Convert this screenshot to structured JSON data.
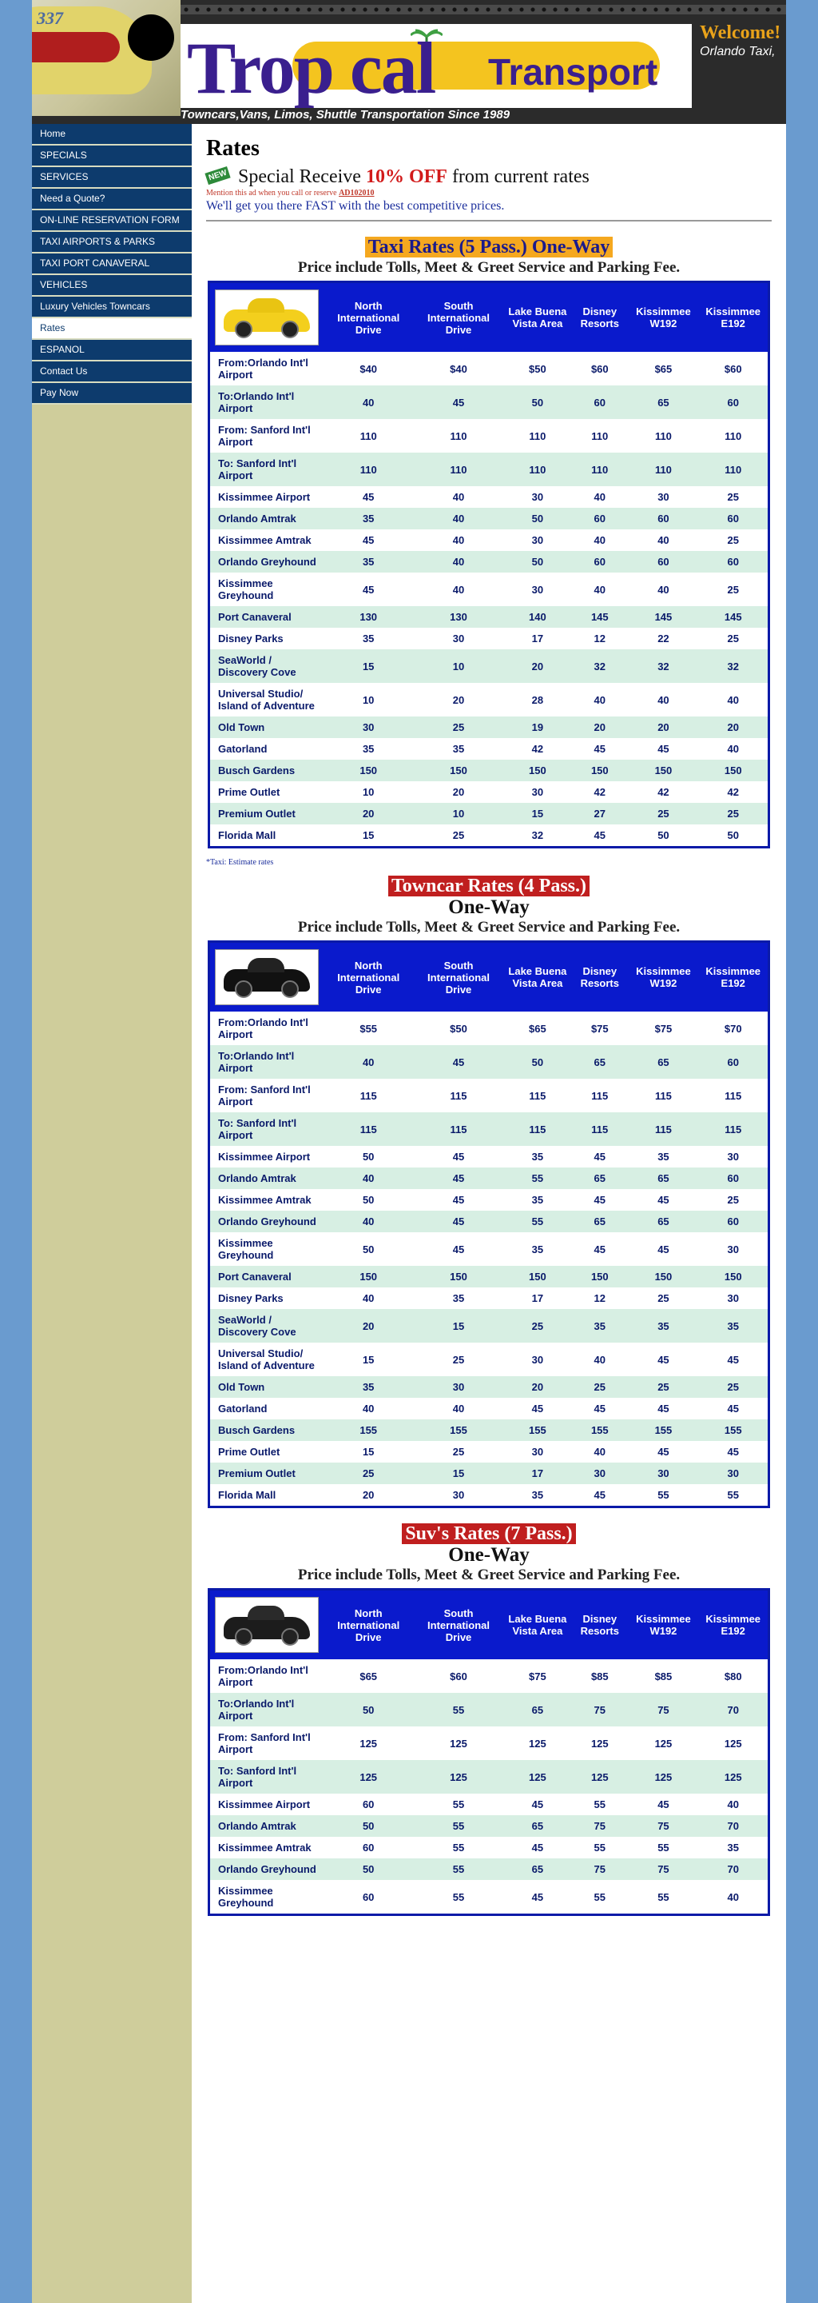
{
  "header": {
    "logo_main": "Trop  cal",
    "logo_sub": "Transport",
    "welcome": "Welcome!",
    "welcome_sub": "Orlando Taxi,",
    "tagline": "Towncars,Vans, Limos, Shuttle Transportation Since 1989",
    "plate": "337"
  },
  "nav": [
    "Home",
    "SPECIALS",
    "SERVICES",
    "Need a Quote?",
    "ON-LINE RESERVATION FORM",
    "TAXI AIRPORTS & PARKS",
    "TAXI PORT CANAVERAL",
    "VEHICLES",
    "Luxury Vehicles Towncars",
    "Rates",
    "ESPANOL",
    "Contact Us",
    "Pay Now"
  ],
  "nav_active": "Rates",
  "page": {
    "title": "Rates",
    "new_badge": "NEW",
    "special_pre": "Special  Receive ",
    "special_off": "10% OFF",
    "special_post": " from current rates",
    "mention_pre": "Mention this ad when you call or reserve ",
    "mention_code": "AD102010",
    "promise": "We'll get you there FAST with the best competitive prices."
  },
  "columns": [
    "North International Drive",
    "South International Drive",
    "Lake Buena Vista Area",
    "Disney Resorts",
    "Kissimmee W192",
    "Kissimmee E192"
  ],
  "sections": {
    "taxi": {
      "title": "Taxi Rates (5 Pass.) One-Way",
      "fee": "Price include Tolls, Meet & Greet Service and Parking Fee.",
      "note": "*Taxi: Estimate rates",
      "rows": [
        [
          "From:Orlando Int'l Airport",
          "$40",
          "$40",
          "$50",
          "$60",
          "$65",
          "$60"
        ],
        [
          "To:Orlando Int'l Airport",
          "40",
          "45",
          "50",
          "60",
          "65",
          "60"
        ],
        [
          "From: Sanford Int'l Airport",
          "110",
          "110",
          "110",
          "110",
          "110",
          "110"
        ],
        [
          "To: Sanford Int'l Airport",
          "110",
          "110",
          "110",
          "110",
          "110",
          "110"
        ],
        [
          "Kissimmee Airport",
          "45",
          "40",
          "30",
          "40",
          "30",
          "25"
        ],
        [
          "Orlando Amtrak",
          "35",
          "40",
          "50",
          "60",
          "60",
          "60"
        ],
        [
          "Kissimmee Amtrak",
          "45",
          "40",
          "30",
          "40",
          "40",
          "25"
        ],
        [
          "Orlando Greyhound",
          "35",
          "40",
          "50",
          "60",
          "60",
          "60"
        ],
        [
          "Kissimmee Greyhound",
          "45",
          "40",
          "30",
          "40",
          "40",
          "25"
        ],
        [
          "Port Canaveral",
          "130",
          "130",
          "140",
          "145",
          "145",
          "145"
        ],
        [
          "Disney Parks",
          "35",
          "30",
          "17",
          "12",
          "22",
          "25"
        ],
        [
          "SeaWorld / Discovery Cove",
          "15",
          "10",
          "20",
          "32",
          "32",
          "32"
        ],
        [
          "Universal Studio/ Island of Adventure",
          "10",
          "20",
          "28",
          "40",
          "40",
          "40"
        ],
        [
          "Old Town",
          "30",
          "25",
          "19",
          "20",
          "20",
          "20"
        ],
        [
          "Gatorland",
          "35",
          "35",
          "42",
          "45",
          "45",
          "40"
        ],
        [
          "Busch Gardens",
          "150",
          "150",
          "150",
          "150",
          "150",
          "150"
        ],
        [
          "Prime Outlet",
          "10",
          "20",
          "30",
          "42",
          "42",
          "42"
        ],
        [
          "Premium Outlet",
          "20",
          "10",
          "15",
          "27",
          "25",
          "25"
        ],
        [
          "Florida Mall",
          "15",
          "25",
          "32",
          "45",
          "50",
          "50"
        ]
      ]
    },
    "towncar": {
      "title": "Towncar Rates (4 Pass.)",
      "sub": "One-Way",
      "fee": "Price include Tolls, Meet & Greet Service and Parking Fee.",
      "rows": [
        [
          "From:Orlando Int'l Airport",
          "$55",
          "$50",
          "$65",
          "$75",
          "$75",
          "$70"
        ],
        [
          "To:Orlando Int'l Airport",
          "40",
          "45",
          "50",
          "65",
          "65",
          "60"
        ],
        [
          "From: Sanford Int'l Airport",
          "115",
          "115",
          "115",
          "115",
          "115",
          "115"
        ],
        [
          "To: Sanford Int'l Airport",
          "115",
          "115",
          "115",
          "115",
          "115",
          "115"
        ],
        [
          "Kissimmee Airport",
          "50",
          "45",
          "35",
          "45",
          "35",
          "30"
        ],
        [
          "Orlando Amtrak",
          "40",
          "45",
          "55",
          "65",
          "65",
          "60"
        ],
        [
          "Kissimmee Amtrak",
          "50",
          "45",
          "35",
          "45",
          "45",
          "25"
        ],
        [
          "Orlando Greyhound",
          "40",
          "45",
          "55",
          "65",
          "65",
          "60"
        ],
        [
          "Kissimmee Greyhound",
          "50",
          "45",
          "35",
          "45",
          "45",
          "30"
        ],
        [
          "Port Canaveral",
          "150",
          "150",
          "150",
          "150",
          "150",
          "150"
        ],
        [
          "Disney Parks",
          "40",
          "35",
          "17",
          "12",
          "25",
          "30"
        ],
        [
          "SeaWorld / Discovery Cove",
          "20",
          "15",
          "25",
          "35",
          "35",
          "35"
        ],
        [
          "Universal Studio/ Island of Adventure",
          "15",
          "25",
          "30",
          "40",
          "45",
          "45"
        ],
        [
          "Old Town",
          "35",
          "30",
          "20",
          "25",
          "25",
          "25"
        ],
        [
          "Gatorland",
          "40",
          "40",
          "45",
          "45",
          "45",
          "45"
        ],
        [
          "Busch Gardens",
          "155",
          "155",
          "155",
          "155",
          "155",
          "155"
        ],
        [
          "Prime Outlet",
          "15",
          "25",
          "30",
          "40",
          "45",
          "45"
        ],
        [
          "Premium Outlet",
          "25",
          "15",
          "17",
          "30",
          "30",
          "30"
        ],
        [
          "Florida Mall",
          "20",
          "30",
          "35",
          "45",
          "55",
          "55"
        ]
      ]
    },
    "suv": {
      "title": "Suv's Rates (7 Pass.)",
      "sub": "One-Way",
      "fee": "Price include Tolls, Meet & Greet Service and Parking Fee.",
      "rows": [
        [
          "From:Orlando Int'l Airport",
          "$65",
          "$60",
          "$75",
          "$85",
          "$85",
          "$80"
        ],
        [
          "To:Orlando Int'l Airport",
          "50",
          "55",
          "65",
          "75",
          "75",
          "70"
        ],
        [
          "From: Sanford Int'l Airport",
          "125",
          "125",
          "125",
          "125",
          "125",
          "125"
        ],
        [
          "To: Sanford Int'l Airport",
          "125",
          "125",
          "125",
          "125",
          "125",
          "125"
        ],
        [
          "Kissimmee Airport",
          "60",
          "55",
          "45",
          "55",
          "45",
          "40"
        ],
        [
          "Orlando Amtrak",
          "50",
          "55",
          "65",
          "75",
          "75",
          "70"
        ],
        [
          "Kissimmee Amtrak",
          "60",
          "55",
          "45",
          "55",
          "55",
          "35"
        ],
        [
          "Orlando Greyhound",
          "50",
          "55",
          "65",
          "75",
          "75",
          "70"
        ],
        [
          "Kissimmee Greyhound",
          "60",
          "55",
          "45",
          "55",
          "55",
          "40"
        ]
      ]
    }
  },
  "colors": {
    "nav_bg": "#0d3b6d",
    "table_header": "#0a1acc",
    "row_alt": "#d7efe3",
    "taxi_title_bg": "#f5a81f",
    "red_title_bg": "#c01f1f"
  }
}
